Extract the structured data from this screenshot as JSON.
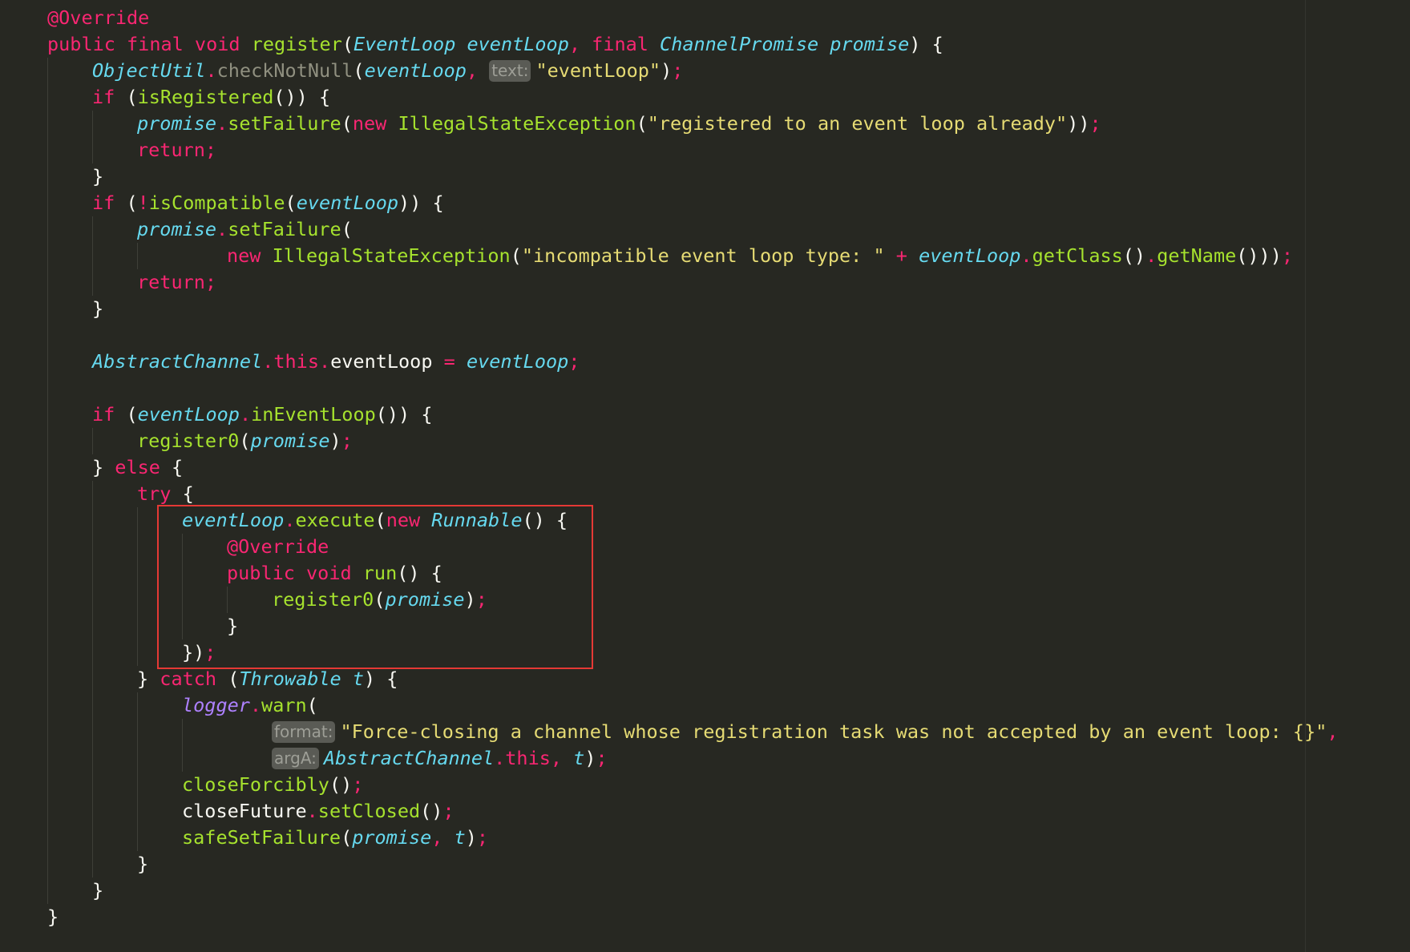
{
  "editor": {
    "colors": {
      "background": "#272822",
      "keyword": "#f92672",
      "function": "#a6e22e",
      "type": "#66d9ef",
      "string": "#e6db74",
      "text": "#f8f8f2",
      "static_field": "#ae81ff",
      "deprecated": "#909080",
      "inlay_hint_bg": "#5a5b55",
      "highlight_box": "#e53935"
    },
    "lines": [
      [
        [
          "annot",
          "@Override"
        ]
      ],
      [
        [
          "kw",
          "public final void "
        ],
        [
          "fn",
          "register"
        ],
        [
          "punc",
          "("
        ],
        [
          "type",
          "EventLoop"
        ],
        [
          "punc",
          " "
        ],
        [
          "param",
          "eventLoop"
        ],
        [
          "op",
          ", "
        ],
        [
          "kw",
          "final "
        ],
        [
          "type",
          "ChannelPromise"
        ],
        [
          "punc",
          " "
        ],
        [
          "param",
          "promise"
        ],
        [
          "punc",
          ") {"
        ]
      ],
      [
        [
          "type",
          "ObjectUtil"
        ],
        [
          "op",
          "."
        ],
        [
          "dep",
          "checkNotNull"
        ],
        [
          "punc",
          "("
        ],
        [
          "param",
          "eventLoop"
        ],
        [
          "op",
          ", "
        ],
        [
          "hint",
          "text:"
        ],
        [
          "str",
          "\"eventLoop\""
        ],
        [
          "punc",
          ")"
        ],
        [
          "op",
          ";"
        ]
      ],
      [
        [
          "kw",
          "if "
        ],
        [
          "punc",
          "("
        ],
        [
          "fn",
          "isRegistered"
        ],
        [
          "punc",
          "()) {"
        ]
      ],
      [
        [
          "param",
          "promise"
        ],
        [
          "op",
          "."
        ],
        [
          "fn",
          "setFailure"
        ],
        [
          "punc",
          "("
        ],
        [
          "kw",
          "new "
        ],
        [
          "fn",
          "IllegalStateException"
        ],
        [
          "punc",
          "("
        ],
        [
          "str",
          "\"registered to an event loop already\""
        ],
        [
          "punc",
          "))"
        ],
        [
          "op",
          ";"
        ]
      ],
      [
        [
          "kw",
          "return"
        ],
        [
          "op",
          ";"
        ]
      ],
      [
        [
          "punc",
          "}"
        ]
      ],
      [
        [
          "kw",
          "if "
        ],
        [
          "punc",
          "("
        ],
        [
          "op",
          "!"
        ],
        [
          "fn",
          "isCompatible"
        ],
        [
          "punc",
          "("
        ],
        [
          "param",
          "eventLoop"
        ],
        [
          "punc",
          ")) {"
        ]
      ],
      [
        [
          "param",
          "promise"
        ],
        [
          "op",
          "."
        ],
        [
          "fn",
          "setFailure"
        ],
        [
          "punc",
          "("
        ]
      ],
      [
        [
          "kw",
          "new "
        ],
        [
          "fn",
          "IllegalStateException"
        ],
        [
          "punc",
          "("
        ],
        [
          "str",
          "\"incompatible event loop type: \""
        ],
        [
          "op",
          " + "
        ],
        [
          "param",
          "eventLoop"
        ],
        [
          "op",
          "."
        ],
        [
          "fn",
          "getClass"
        ],
        [
          "punc",
          "()"
        ],
        [
          "op",
          "."
        ],
        [
          "fn",
          "getName"
        ],
        [
          "punc",
          "()))"
        ],
        [
          "op",
          ";"
        ]
      ],
      [
        [
          "kw",
          "return"
        ],
        [
          "op",
          ";"
        ]
      ],
      [
        [
          "punc",
          "}"
        ]
      ],
      [],
      [
        [
          "type",
          "AbstractChannel"
        ],
        [
          "op",
          "."
        ],
        [
          "kw",
          "this"
        ],
        [
          "op",
          "."
        ],
        [
          "plain",
          "eventLoop"
        ],
        [
          "op",
          " = "
        ],
        [
          "param",
          "eventLoop"
        ],
        [
          "op",
          ";"
        ]
      ],
      [],
      [
        [
          "kw",
          "if "
        ],
        [
          "punc",
          "("
        ],
        [
          "param",
          "eventLoop"
        ],
        [
          "op",
          "."
        ],
        [
          "fn",
          "inEventLoop"
        ],
        [
          "punc",
          "()) {"
        ]
      ],
      [
        [
          "fn",
          "register0"
        ],
        [
          "punc",
          "("
        ],
        [
          "param",
          "promise"
        ],
        [
          "punc",
          ")"
        ],
        [
          "op",
          ";"
        ]
      ],
      [
        [
          "punc",
          "} "
        ],
        [
          "kw",
          "else "
        ],
        [
          "punc",
          "{"
        ]
      ],
      [
        [
          "kw",
          "try "
        ],
        [
          "punc",
          "{"
        ]
      ],
      [
        [
          "param",
          "eventLoop"
        ],
        [
          "op",
          "."
        ],
        [
          "fn",
          "execute"
        ],
        [
          "punc",
          "("
        ],
        [
          "kw",
          "new "
        ],
        [
          "type",
          "Runnable"
        ],
        [
          "punc",
          "() {"
        ]
      ],
      [
        [
          "annot",
          "@Override"
        ]
      ],
      [
        [
          "kw",
          "public void "
        ],
        [
          "fn",
          "run"
        ],
        [
          "punc",
          "() {"
        ]
      ],
      [
        [
          "fn",
          "register0"
        ],
        [
          "punc",
          "("
        ],
        [
          "param",
          "promise"
        ],
        [
          "punc",
          ")"
        ],
        [
          "op",
          ";"
        ]
      ],
      [
        [
          "punc",
          "}"
        ]
      ],
      [
        [
          "punc",
          "})"
        ],
        [
          "op",
          ";"
        ]
      ],
      [
        [
          "punc",
          "} "
        ],
        [
          "kw",
          "catch "
        ],
        [
          "punc",
          "("
        ],
        [
          "type",
          "Throwable"
        ],
        [
          "punc",
          " "
        ],
        [
          "param",
          "t"
        ],
        [
          "punc",
          ") {"
        ]
      ],
      [
        [
          "static",
          "logger"
        ],
        [
          "op",
          "."
        ],
        [
          "fn",
          "warn"
        ],
        [
          "punc",
          "("
        ]
      ],
      [
        [
          "hint",
          "format:"
        ],
        [
          "str",
          "\"Force-closing a channel whose registration task was not accepted by an event loop: {}\""
        ],
        [
          "op",
          ","
        ]
      ],
      [
        [
          "hint",
          "argA:"
        ],
        [
          "type",
          "AbstractChannel"
        ],
        [
          "op",
          "."
        ],
        [
          "kw",
          "this"
        ],
        [
          "op",
          ", "
        ],
        [
          "param",
          "t"
        ],
        [
          "punc",
          ")"
        ],
        [
          "op",
          ";"
        ]
      ],
      [
        [
          "fn",
          "closeForcibly"
        ],
        [
          "punc",
          "()"
        ],
        [
          "op",
          ";"
        ]
      ],
      [
        [
          "plain",
          "closeFuture"
        ],
        [
          "op",
          "."
        ],
        [
          "fn",
          "setClosed"
        ],
        [
          "punc",
          "()"
        ],
        [
          "op",
          ";"
        ]
      ],
      [
        [
          "fn",
          "safeSetFailure"
        ],
        [
          "punc",
          "("
        ],
        [
          "param",
          "promise"
        ],
        [
          "op",
          ", "
        ],
        [
          "param",
          "t"
        ],
        [
          "punc",
          ")"
        ],
        [
          "op",
          ";"
        ]
      ],
      [
        [
          "punc",
          "}"
        ]
      ],
      [
        [
          "punc",
          "}"
        ]
      ],
      [
        [
          "punc",
          "}"
        ]
      ]
    ]
  }
}
